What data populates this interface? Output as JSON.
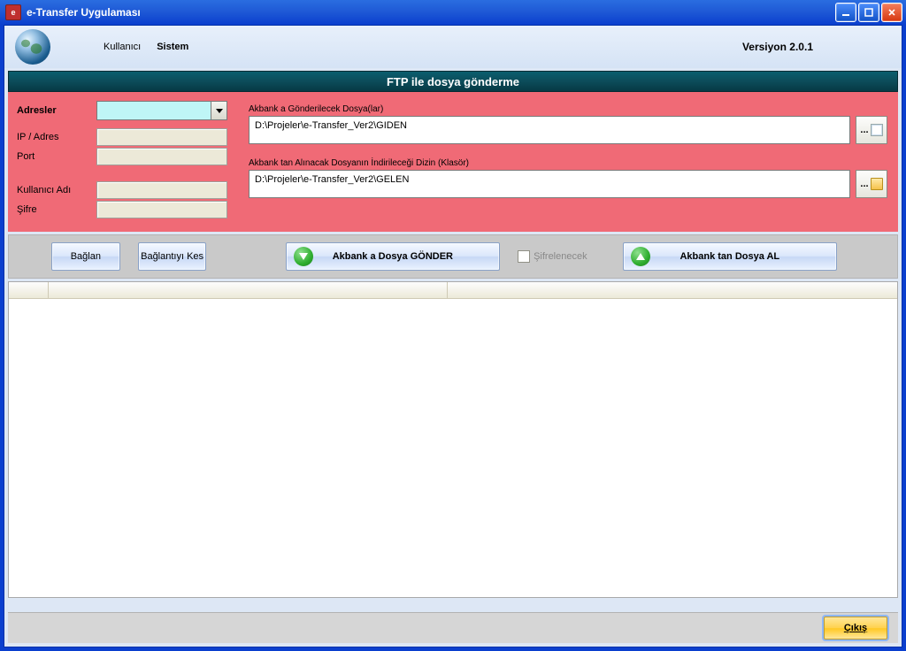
{
  "window": {
    "title": "e-Transfer Uygulaması"
  },
  "header": {
    "menu": {
      "user": "Kullanıcı",
      "system": "Sistem"
    },
    "version": "Versiyon 2.0.1"
  },
  "section_title": "FTP ile dosya gönderme",
  "form": {
    "addresses_label": "Adresler",
    "ip_label": "IP / Adres",
    "port_label": "Port",
    "user_label": "Kullanıcı Adı",
    "pass_label": "Şifre",
    "send_files_label": "Akbank a Gönderilecek Dosya(lar)",
    "send_path": "D:\\Projeler\\e-Transfer_Ver2\\GIDEN",
    "recv_dir_label": "Akbank tan Alınacak Dosyanın İndirileceği Dizin (Klasör)",
    "recv_path": "D:\\Projeler\\e-Transfer_Ver2\\GELEN",
    "browse": "..."
  },
  "actions": {
    "connect": "Bağlan",
    "disconnect": "Bağlantıyı Kes",
    "send": "Akbank a Dosya GÖNDER",
    "encrypt": "Şifrelenecek",
    "receive": "Akbank tan Dosya AL"
  },
  "footer": {
    "exit": "Çıkış"
  }
}
